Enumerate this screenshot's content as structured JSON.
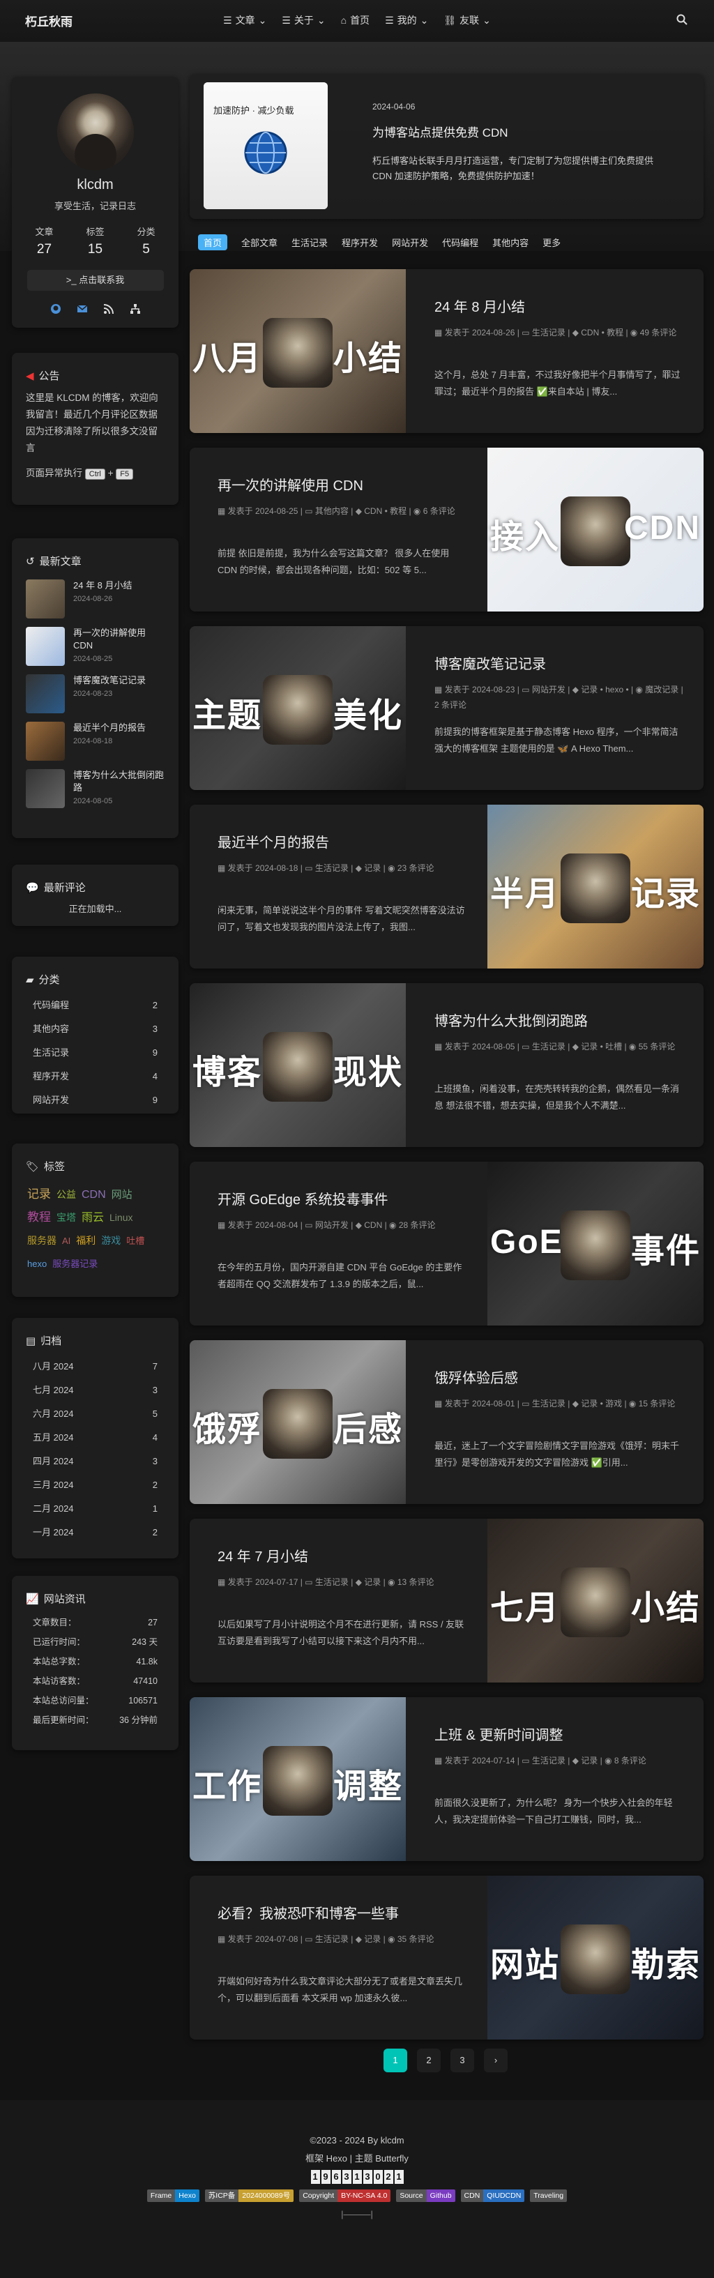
{
  "header": {
    "site_name": "朽丘秋雨",
    "menus": [
      {
        "label": "文章",
        "icon": "book-icon"
      },
      {
        "label": "关于",
        "icon": "list-icon"
      },
      {
        "label": "首页",
        "icon": "home-icon"
      },
      {
        "label": "我的",
        "icon": "list-icon"
      },
      {
        "label": "友联",
        "icon": "link-icon"
      }
    ]
  },
  "profile": {
    "author": "klcdm",
    "description": "享受生活，记录日志",
    "stats": [
      {
        "label": "文章",
        "value": "27"
      },
      {
        "label": "标签",
        "value": "15"
      },
      {
        "label": "分类",
        "value": "5"
      }
    ],
    "follow_label": "点击联系我"
  },
  "announcement": {
    "title": "公告",
    "text": "这里是 KLCDM 的博客，欢迎向我留言！最近几个月评论区数据因为迁移清除了所以很多文没留言",
    "hint_prefix": "页面异常执行",
    "kbd1": "Ctrl",
    "plus": "+",
    "kbd2": "F5"
  },
  "recent": {
    "title": "最新文章",
    "items": [
      {
        "title": "24 年 8 月小结",
        "date": "2024-08-26"
      },
      {
        "title": "再一次的讲解使用 CDN",
        "date": "2024-08-25"
      },
      {
        "title": "博客魔改笔记记录",
        "date": "2024-08-23"
      },
      {
        "title": "最近半个月的报告",
        "date": "2024-08-18"
      },
      {
        "title": "博客为什么大批倒闭跑路",
        "date": "2024-08-05"
      }
    ]
  },
  "comments": {
    "title": "最新评论",
    "loading": "正在加载中..."
  },
  "categories": {
    "title": "分类",
    "items": [
      {
        "name": "代码编程",
        "count": "2"
      },
      {
        "name": "其他内容",
        "count": "3"
      },
      {
        "name": "生活记录",
        "count": "9"
      },
      {
        "name": "程序开发",
        "count": "4"
      },
      {
        "name": "网站开发",
        "count": "9"
      }
    ]
  },
  "tags": {
    "title": "标签",
    "items": [
      {
        "name": "记录",
        "color": "#c8a45a",
        "size": "17"
      },
      {
        "name": "公益",
        "color": "#a0b83a",
        "size": "14"
      },
      {
        "name": "CDN",
        "color": "#8b6fb5",
        "size": "16"
      },
      {
        "name": "网站",
        "color": "#6b9e7a",
        "size": "15"
      },
      {
        "name": "教程",
        "color": "#b04c9c",
        "size": "17"
      },
      {
        "name": "宝塔",
        "color": "#3a9e6e",
        "size": "14"
      },
      {
        "name": "雨云",
        "color": "#9bbf2a",
        "size": "16"
      },
      {
        "name": "Linux",
        "color": "#7b8c6a",
        "size": "14"
      },
      {
        "name": "服务器",
        "color": "#b59a2a",
        "size": "14"
      },
      {
        "name": "AI",
        "color": "#b05a5a",
        "size": "13"
      },
      {
        "name": "福利",
        "color": "#d0a020",
        "size": "14"
      },
      {
        "name": "游戏",
        "color": "#3a8c9e",
        "size": "14"
      },
      {
        "name": "吐槽",
        "color": "#c05050",
        "size": "13"
      },
      {
        "name": "hexo",
        "color": "#5a9ee0",
        "size": "13"
      },
      {
        "name": "服务器记录",
        "color": "#7a4cc0",
        "size": "13"
      }
    ]
  },
  "archives": {
    "title": "归档",
    "items": [
      {
        "month": "八月 2024",
        "count": "7"
      },
      {
        "month": "七月 2024",
        "count": "3"
      },
      {
        "month": "六月 2024",
        "count": "5"
      },
      {
        "month": "五月 2024",
        "count": "4"
      },
      {
        "month": "四月 2024",
        "count": "3"
      },
      {
        "month": "三月 2024",
        "count": "2"
      },
      {
        "month": "二月 2024",
        "count": "1"
      },
      {
        "month": "一月 2024",
        "count": "2"
      }
    ]
  },
  "site_info": {
    "title": "网站资讯",
    "items": [
      {
        "label": "文章数目：",
        "value": "27"
      },
      {
        "label": "已运行时间：",
        "value": "243 天"
      },
      {
        "label": "本站总字数：",
        "value": "41.8k"
      },
      {
        "label": "本站访客数：",
        "value": "47410"
      },
      {
        "label": "本站总访问量：",
        "value": "106571"
      },
      {
        "label": "最后更新时间：",
        "value": "36 分钟前"
      }
    ]
  },
  "featured": {
    "date": "2024-04-06",
    "title": "为博客站点提供免费 CDN",
    "excerpt": "朽丘博客站长联手月月打造运营，专门定制了为您提供博主们免费提供 CDN 加速防护策略，免费提供防护加速！",
    "img_caption": "加速防护 · 减少负载"
  },
  "category_bar": [
    "首页",
    "全部文章",
    "生活记录",
    "程序开发",
    "网站开发",
    "代码编程",
    "其他内容",
    "更多"
  ],
  "posts": [
    {
      "title": "24 年 8 月小结",
      "date": "2024-08-26",
      "cat": "生活记录",
      "tags": "CDN • 教程",
      "comments": "49 条评论",
      "excerpt": "这个月，总处 7 月丰富，不过我好像把半个月事情写了，罪过罪过；最近半个月的报告 ✅来自本站 | 博友...",
      "w1": "八月",
      "w2": "小结"
    },
    {
      "title": "再一次的讲解使用 CDN",
      "date": "2024-08-25",
      "cat": "其他内容",
      "tags": "CDN • 教程",
      "comments": "6 条评论",
      "excerpt": "前提 依旧是前提，我为什么会写这篇文章？ 很多人在使用 CDN 的时候，都会出现各种问题，比如：502 等 5...",
      "w1": "接入",
      "w2": "CDN"
    },
    {
      "title": "博客魔改笔记记录",
      "date": "2024-08-23",
      "cat": "网站开发",
      "tags": "记录 • hexo •",
      "comments": "魔改记录 | 2 条评论",
      "excerpt": "前提我的博客框架是基于静态博客 Hexo 程序，一个非常简洁强大的博客框架 主题使用的是 🦋 A Hexo Them...",
      "w1": "主题",
      "w2": "美化"
    },
    {
      "title": "最近半个月的报告",
      "date": "2024-08-18",
      "cat": "生活记录",
      "tags": "记录",
      "comments": "23 条评论",
      "excerpt": "闲来无事，简单说说这半个月的事件 写着文昵突然博客没法访问了，写着文也发现我的图片没法上传了，我图...",
      "w1": "半月",
      "w2": "记录"
    },
    {
      "title": "博客为什么大批倒闭跑路",
      "date": "2024-08-05",
      "cat": "生活记录",
      "tags": "记录 • 吐槽",
      "comments": "55 条评论",
      "excerpt": "上班摸鱼，闲着没事，在壳壳转转我的企鹅，偶然看见一条消息 想法很不错，想去实操，但是我个人不满楚...",
      "w1": "博客",
      "w2": "现状"
    },
    {
      "title": "开源 GoEdge 系统投毒事件",
      "date": "2024-08-04",
      "cat": "网站开发",
      "tags": "CDN",
      "comments": "28 条评论",
      "excerpt": "在今年的五月份，国内开源自建 CDN 平台 GoEdge 的主要作者超雨在 QQ 交流群发布了 1.3.9 的版本之后，鼠...",
      "w1": "GoE",
      "w2": "事件"
    },
    {
      "title": "饿殍体验后感",
      "date": "2024-08-01",
      "cat": "生活记录",
      "tags": "记录 • 游戏",
      "comments": "15 条评论",
      "excerpt": "最近，迷上了一个文字冒险剧情文字冒险游戏《饿殍：明末千里行》是零创游戏开发的文字冒险游戏 ✅引用...",
      "w1": "饿殍",
      "w2": "后感"
    },
    {
      "title": "24 年 7 月小结",
      "date": "2024-07-17",
      "cat": "生活记录",
      "tags": "记录",
      "comments": "13 条评论",
      "excerpt": "以后如果写了月小计说明这个月不在进行更新，请 RSS / 友联互访要是看到我写了小结可以接下来这个月内不用...",
      "w1": "七月",
      "w2": "小结"
    },
    {
      "title": "上班 & 更新时间调整",
      "date": "2024-07-14",
      "cat": "生活记录",
      "tags": "记录",
      "comments": "8 条评论",
      "excerpt": "前面很久没更新了，为什么呢？ 身为一个快步入社会的年轻人，我决定提前体验一下自己打工赚钱，同时，我...",
      "w1": "工作",
      "w2": "调整"
    },
    {
      "title": "必看？我被恐吓和博客一些事",
      "date": "2024-07-08",
      "cat": "生活记录",
      "tags": "记录",
      "comments": "35 条评论",
      "excerpt": "开端如何好奇为什么我文章评论大部分无了或者是文章丢失几个，可以翻到后面看 本文采用 wp 加速永久彼...",
      "w1": "网站",
      "w2": "勒索"
    }
  ],
  "meta_labels": {
    "posted": "发表于"
  },
  "pager": [
    "1",
    "2",
    "3",
    "›"
  ],
  "footer": {
    "copyright": "©2023 - 2024 By klcdm",
    "framework": "框架 Hexo | 主题 Butterfly",
    "counter": "196313021",
    "badges": [
      {
        "a": "Frame",
        "b": "Hexo",
        "color": "#0e83cd"
      },
      {
        "a": "苏ICP备",
        "b": "2024000089号",
        "color": "#c8a030"
      },
      {
        "a": "Copyright",
        "b": "BY-NC-SA 4.0",
        "color": "#c03030"
      },
      {
        "a": "Source",
        "b": "Github",
        "color": "#7a3cc0"
      },
      {
        "a": "CDN",
        "b": "QIUDCDN",
        "color": "#2a6fc0"
      },
      {
        "a": "Traveling",
        "b": "",
        "color": "#555"
      }
    ]
  }
}
